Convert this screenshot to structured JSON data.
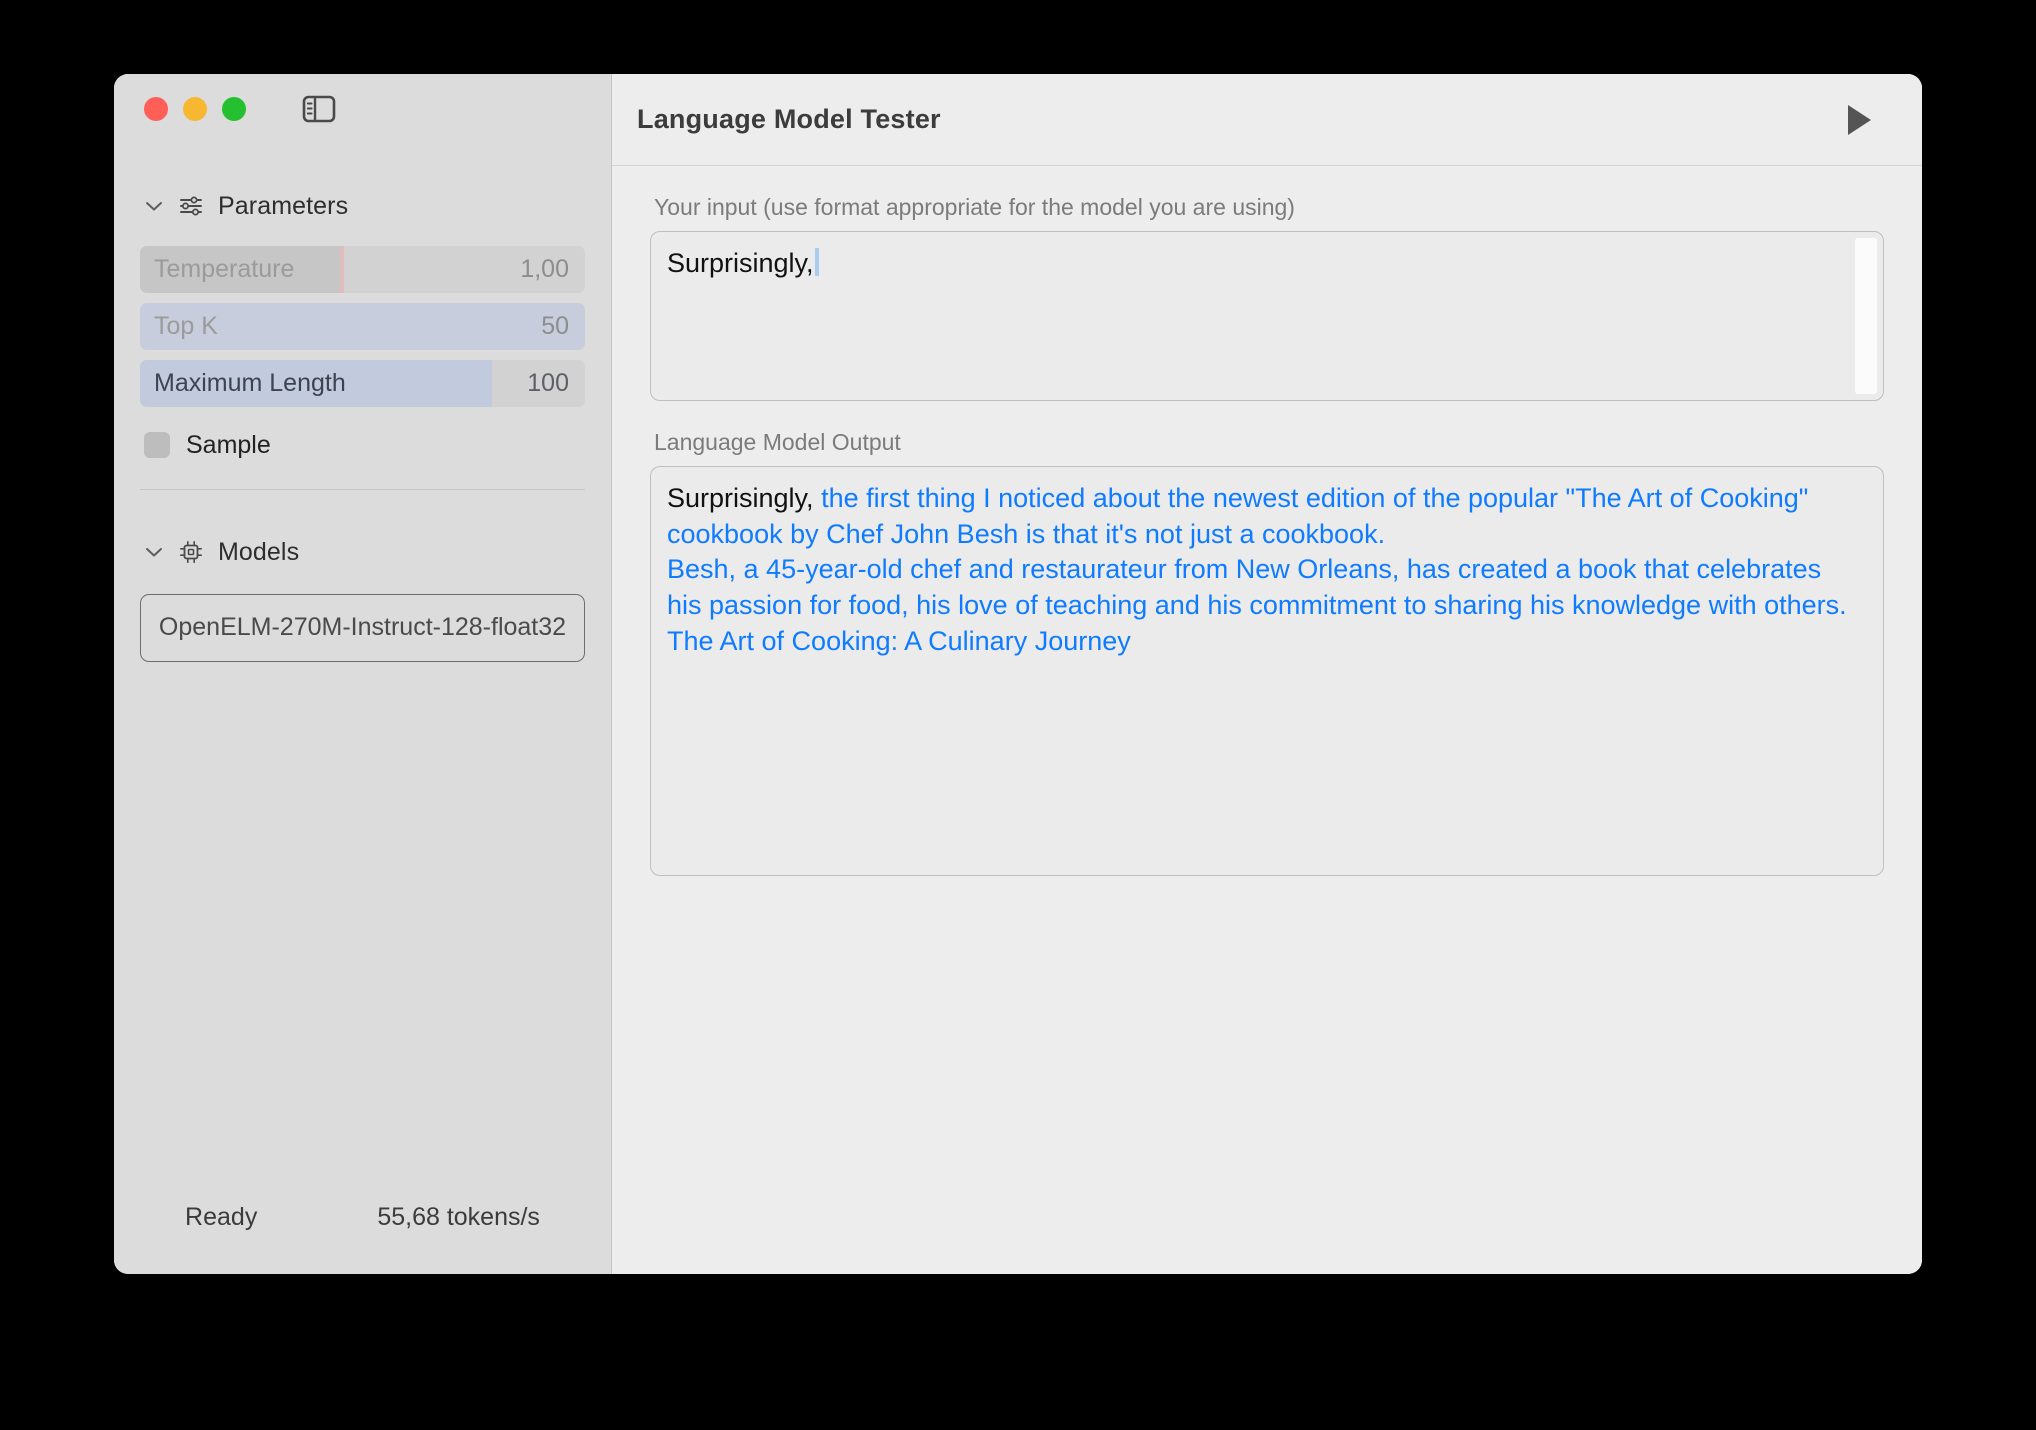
{
  "window": {
    "traffic_lights": [
      {
        "name": "close",
        "color": "#ff5f57"
      },
      {
        "name": "minimize",
        "color": "#f7b731"
      },
      {
        "name": "zoom",
        "color": "#24c030"
      }
    ],
    "sidebar_toggle_icon": "sidebar-toggle-icon"
  },
  "sidebar": {
    "sections": [
      {
        "id": "parameters",
        "label": "Parameters",
        "icon": "sliders-icon",
        "chevron": "chevron-down-icon"
      },
      {
        "id": "models",
        "label": "Models",
        "icon": "chip-icon",
        "chevron": "chevron-down-icon"
      }
    ],
    "parameters": [
      {
        "label": "Temperature",
        "value": "1,00",
        "fill_pct": 45,
        "marker_pct": 45,
        "active": false,
        "style": "gray"
      },
      {
        "label": "Top K",
        "value": "50",
        "fill_pct": 100,
        "active": false,
        "style": "blue"
      },
      {
        "label": "Maximum Length",
        "value": "100",
        "fill_pct": 79,
        "active": true,
        "style": "blue"
      }
    ],
    "sample": {
      "label": "Sample",
      "checked": false
    },
    "models": {
      "selected_model": "OpenELM-270M-Instruct-128-float32"
    },
    "status": {
      "state": "Ready",
      "throughput": "55,68 tokens/s"
    }
  },
  "main": {
    "title": "Language Model Tester",
    "run_icon": "play-icon",
    "input": {
      "label": "Your input (use format appropriate for the model you are using)",
      "value": "Surprisingly,",
      "placeholder": ""
    },
    "output": {
      "label": "Language Model Output",
      "prompt_echo": "Surprisingly,",
      "generated_text": " the first thing I noticed about the newest edition of the popular \"The Art of Cooking\" cookbook by Chef John Besh is that it's not just a cookbook.\nBesh, a 45-year-old chef and restaurateur from New Orleans, has created a book that celebrates his passion for food, his love of teaching and his commitment to sharing his knowledge with others.\nThe Art of Cooking: A Culinary Journey"
    }
  },
  "colors": {
    "accent_blue": "#0f7bff",
    "caret": "#a8cdf0",
    "sidebar_bg": "#dcdcdc",
    "main_bg": "#ededed"
  }
}
